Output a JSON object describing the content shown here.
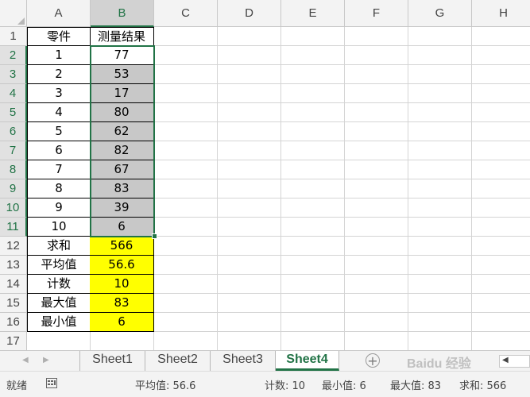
{
  "columns": [
    "A",
    "B",
    "C",
    "D",
    "E",
    "F",
    "G",
    "H"
  ],
  "rows": [
    1,
    2,
    3,
    4,
    5,
    6,
    7,
    8,
    9,
    10,
    11,
    12,
    13,
    14,
    15,
    16,
    17
  ],
  "headers": {
    "part": "零件",
    "result": "测量结果"
  },
  "data_rows": [
    {
      "part": "1",
      "result": "77"
    },
    {
      "part": "2",
      "result": "53"
    },
    {
      "part": "3",
      "result": "17"
    },
    {
      "part": "4",
      "result": "80"
    },
    {
      "part": "5",
      "result": "62"
    },
    {
      "part": "6",
      "result": "82"
    },
    {
      "part": "7",
      "result": "67"
    },
    {
      "part": "8",
      "result": "83"
    },
    {
      "part": "9",
      "result": "39"
    },
    {
      "part": "10",
      "result": "6"
    }
  ],
  "summary_rows": [
    {
      "label": "求和",
      "value": "566"
    },
    {
      "label": "平均值",
      "value": "56.6"
    },
    {
      "label": "计数",
      "value": "10"
    },
    {
      "label": "最大值",
      "value": "83"
    },
    {
      "label": "最小值",
      "value": "6"
    }
  ],
  "sheets": [
    "Sheet1",
    "Sheet2",
    "Sheet3",
    "Sheet4"
  ],
  "active_sheet": "Sheet4",
  "status": {
    "ready": "就绪",
    "average": "平均值: 56.6",
    "count": "计数: 10",
    "min": "最小值: 6",
    "max": "最大值: 83",
    "sum": "求和: 566"
  },
  "watermark": "Baidu 经验",
  "colors": {
    "accent": "#217346",
    "highlight_yellow": "#ffff00",
    "selection_gray": "#c8c8c8"
  }
}
